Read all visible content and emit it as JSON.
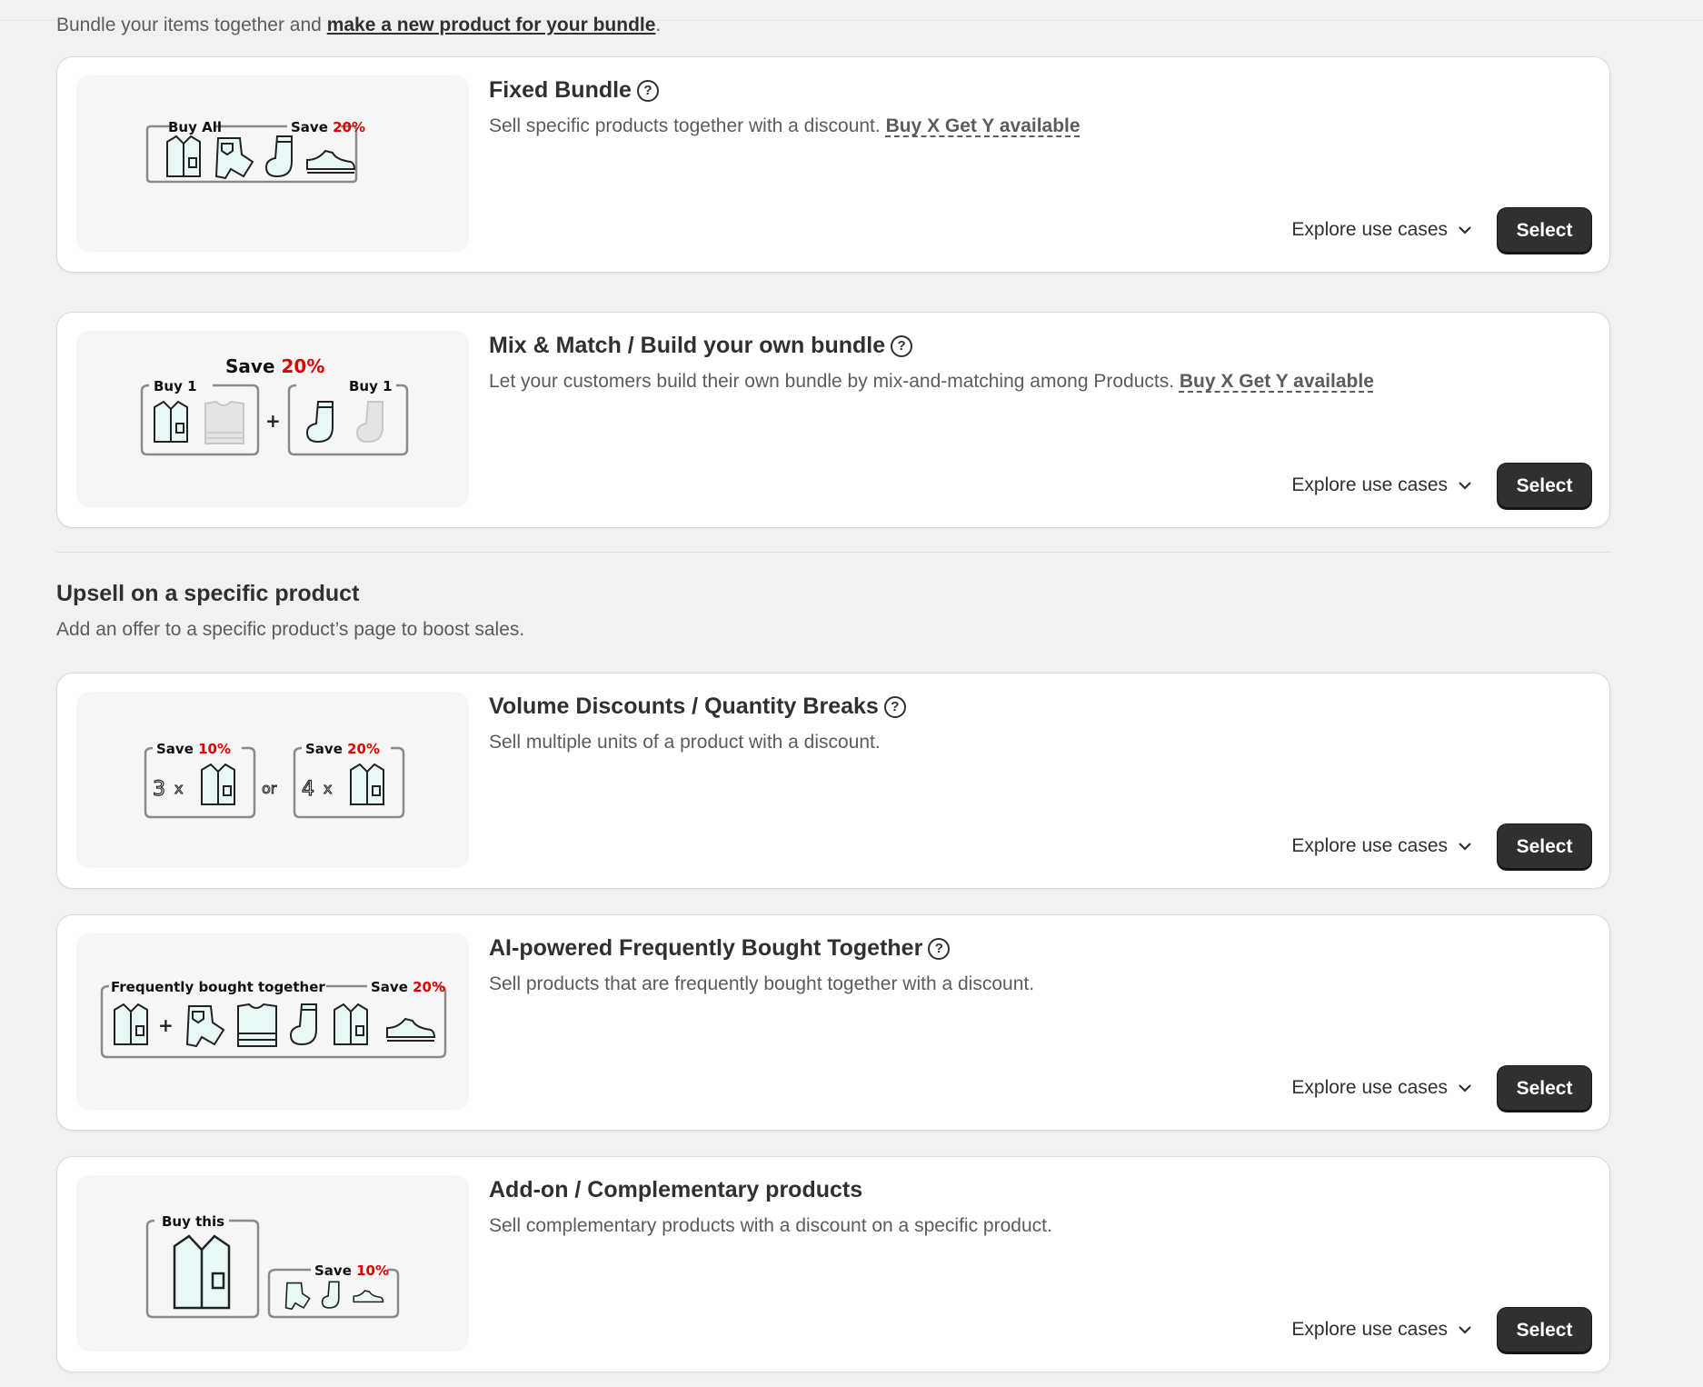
{
  "intro": {
    "text": "Bundle your items together and ",
    "link": "make a new product for your bundle",
    "end": "."
  },
  "cards": [
    {
      "title": "Fixed Bundle",
      "has_help": true,
      "description": "Sell specific products together with a discount. ",
      "bxgy": "Buy X Get Y available",
      "explore": "Explore use cases",
      "select": "Select",
      "thumb": {
        "label1": "Buy All",
        "save": "Save",
        "pct": "20%"
      }
    },
    {
      "title": "Mix & Match / Build your own bundle",
      "has_help": true,
      "description": "Let your customers build their own bundle by mix-and-matching among Products. ",
      "bxgy": "Buy X Get Y available",
      "explore": "Explore use cases",
      "select": "Select",
      "thumb": {
        "save": "Save",
        "pct": "20%",
        "buy1": "Buy 1",
        "buy2": "Buy 1"
      }
    },
    {
      "title": "Volume Discounts / Quantity Breaks",
      "has_help": true,
      "description": "Sell multiple units of a product with a discount.",
      "explore": "Explore use cases",
      "select": "Select",
      "thumb": {
        "save": "Save",
        "pct1": "10%",
        "pct2": "20%",
        "q1": "3",
        "q2": "4",
        "x": "x",
        "or": "or"
      }
    },
    {
      "title": "AI-powered Frequently Bought Together",
      "has_help": true,
      "description": "Sell products that are frequently bought together with a discount.",
      "explore": "Explore use cases",
      "select": "Select",
      "thumb": {
        "label1": "Frequently bought together",
        "save": "Save",
        "pct": "20%"
      }
    },
    {
      "title": "Add-on / Complementary products",
      "has_help": false,
      "description": "Sell complementary products with a discount on a specific product.",
      "explore": "Explore use cases",
      "select": "Select",
      "thumb": {
        "label1": "Buy this",
        "save": "Save",
        "pct": "10%"
      }
    }
  ],
  "section": {
    "title": "Upsell on a specific product",
    "subtitle": "Add an offer to a specific product’s page to boost sales."
  },
  "colors": {
    "accent_red": "#e00000",
    "icon_fill": "#e8f8f6",
    "button": "#303030"
  }
}
